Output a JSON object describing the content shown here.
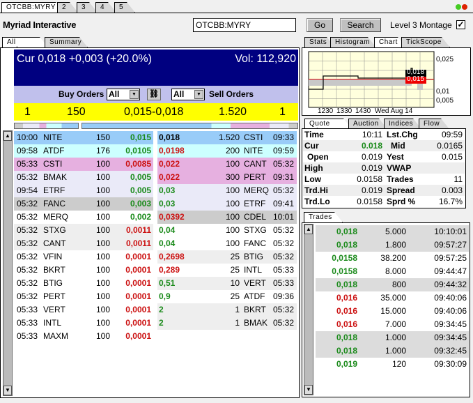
{
  "window": {
    "tabs": [
      "OTCBB:MYRY",
      "2",
      "3",
      "4",
      "5"
    ],
    "status_dots": [
      "#44cc22",
      "#dd2200"
    ]
  },
  "header": {
    "company": "Myriad Interactive",
    "symbol_value": "OTCBB:MYRY",
    "go": "Go",
    "search": "Search",
    "level3_label": "Level 3 Montage",
    "level3_checked": true
  },
  "left_tabs": [
    "All orders",
    "Summary"
  ],
  "summary": {
    "cur": "Cur 0,018 +0,003 (+20.0%)",
    "vol": "Vol: 112,920"
  },
  "filters": {
    "buy_label": "Buy Orders",
    "buy_value": "All",
    "sell_value": "All",
    "sell_label": "Sell Orders",
    "link_icon": "link-icon"
  },
  "inside": {
    "bid_count": "1",
    "bid_size": "150",
    "spread": "0,015-0,018",
    "ask_size": "1.520",
    "ask_count": "1"
  },
  "colors": {
    "blue": "#99ccf8",
    "cyan": "#ccffff",
    "pink": "#e6b0e0",
    "lavender": "#eaeaf8",
    "gray": "#cccccc",
    "lightgray": "#eeeeee",
    "white": "#ffffff",
    "green": "#1a8a1a",
    "red": "#cc1111"
  },
  "bids": [
    {
      "time": "10:00",
      "mm": "NITE",
      "size": "150",
      "price": "0,015",
      "c": "g",
      "bg": "blue"
    },
    {
      "time": "09:58",
      "mm": "ATDF",
      "size": "176",
      "price": "0,0105",
      "c": "g",
      "bg": "cyan"
    },
    {
      "time": "05:33",
      "mm": "CSTI",
      "size": "100",
      "price": "0,0085",
      "c": "r",
      "bg": "pink"
    },
    {
      "time": "05:32",
      "mm": "BMAK",
      "size": "100",
      "price": "0,005",
      "c": "g",
      "bg": "lavender"
    },
    {
      "time": "09:54",
      "mm": "ETRF",
      "size": "100",
      "price": "0,005",
      "c": "g",
      "bg": "lavender"
    },
    {
      "time": "05:32",
      "mm": "FANC",
      "size": "100",
      "price": "0,003",
      "c": "g",
      "bg": "gray"
    },
    {
      "time": "05:32",
      "mm": "MERQ",
      "size": "100",
      "price": "0,002",
      "c": "g",
      "bg": "white"
    },
    {
      "time": "05:32",
      "mm": "STXG",
      "size": "100",
      "price": "0,0011",
      "c": "r",
      "bg": "lightgray"
    },
    {
      "time": "05:32",
      "mm": "CANT",
      "size": "100",
      "price": "0,0011",
      "c": "r",
      "bg": "lightgray"
    },
    {
      "time": "05:32",
      "mm": "VFIN",
      "size": "100",
      "price": "0,0001",
      "c": "r",
      "bg": "white"
    },
    {
      "time": "05:32",
      "mm": "BKRT",
      "size": "100",
      "price": "0,0001",
      "c": "r",
      "bg": "white"
    },
    {
      "time": "05:32",
      "mm": "BTIG",
      "size": "100",
      "price": "0,0001",
      "c": "r",
      "bg": "white"
    },
    {
      "time": "05:32",
      "mm": "PERT",
      "size": "100",
      "price": "0,0001",
      "c": "r",
      "bg": "white"
    },
    {
      "time": "05:33",
      "mm": "VERT",
      "size": "100",
      "price": "0,0001",
      "c": "r",
      "bg": "white"
    },
    {
      "time": "05:33",
      "mm": "INTL",
      "size": "100",
      "price": "0,0001",
      "c": "r",
      "bg": "white"
    },
    {
      "time": "05:33",
      "mm": "MAXM",
      "size": "100",
      "price": "0,0001",
      "c": "r",
      "bg": "white"
    }
  ],
  "asks": [
    {
      "price": "0,018",
      "size": "1.520",
      "mm": "CSTI",
      "time": "09:33",
      "c": "b",
      "bg": "blue"
    },
    {
      "price": "0,0198",
      "size": "200",
      "mm": "NITE",
      "time": "09:59",
      "c": "r",
      "bg": "cyan"
    },
    {
      "price": "0,022",
      "size": "100",
      "mm": "CANT",
      "time": "05:32",
      "c": "r",
      "bg": "pink"
    },
    {
      "price": "0,022",
      "size": "300",
      "mm": "PERT",
      "time": "09:31",
      "c": "r",
      "bg": "pink"
    },
    {
      "price": "0,03",
      "size": "100",
      "mm": "MERQ",
      "time": "05:32",
      "c": "g",
      "bg": "lavender"
    },
    {
      "price": "0,03",
      "size": "100",
      "mm": "ETRF",
      "time": "09:41",
      "c": "g",
      "bg": "lavender"
    },
    {
      "price": "0,0392",
      "size": "100",
      "mm": "CDEL",
      "time": "10:01",
      "c": "r",
      "bg": "gray"
    },
    {
      "price": "0,04",
      "size": "100",
      "mm": "STXG",
      "time": "05:32",
      "c": "g",
      "bg": "white"
    },
    {
      "price": "0,04",
      "size": "100",
      "mm": "FANC",
      "time": "05:32",
      "c": "g",
      "bg": "white"
    },
    {
      "price": "0,2698",
      "size": "25",
      "mm": "BTIG",
      "time": "05:32",
      "c": "r",
      "bg": "lightgray"
    },
    {
      "price": "0,289",
      "size": "25",
      "mm": "INTL",
      "time": "05:33",
      "c": "r",
      "bg": "white"
    },
    {
      "price": "0,51",
      "size": "10",
      "mm": "VERT",
      "time": "05:33",
      "c": "g",
      "bg": "lightgray"
    },
    {
      "price": "0,9",
      "size": "25",
      "mm": "ATDF",
      "time": "09:36",
      "c": "g",
      "bg": "white"
    },
    {
      "price": "2",
      "size": "1",
      "mm": "BKRT",
      "time": "05:32",
      "c": "g",
      "bg": "lightgray"
    },
    {
      "price": "2",
      "size": "1",
      "mm": "BMAK",
      "time": "05:32",
      "c": "g",
      "bg": "lightgray"
    }
  ],
  "right_tabs": [
    "Stats",
    "Histogram",
    "Chart",
    "TickScope"
  ],
  "chart": {
    "x_ticks": [
      "1230",
      "1330",
      "1430",
      "Wed Aug 14"
    ],
    "y_ticks": [
      "0,025",
      "0,01",
      "0,005"
    ],
    "last_label": "0,018",
    "yest_label": "0,015",
    "last": 0.018,
    "yest": 0.015
  },
  "quote_tabs": [
    "Quote Info",
    "Auction",
    "Indices",
    "Flow"
  ],
  "quote": [
    {
      "l1": "Time",
      "v1": "10:11",
      "l2": "Lst.Chg",
      "v2": "09:59"
    },
    {
      "l1": "Cur",
      "v1": "0.018",
      "l2": "Mid",
      "v2": "0.0165"
    },
    {
      "l1": "Open",
      "v1": "0.019",
      "l2": "Yest",
      "v2": "0.015"
    },
    {
      "l1": "High",
      "v1": "0.019",
      "l2": "VWAP",
      "v2": ""
    },
    {
      "l1": "Low",
      "v1": "0.0158",
      "l2": "Trades",
      "v2": "11"
    },
    {
      "l1": "Trd.Hi",
      "v1": "0.019",
      "l2": "Spread",
      "v2": "0.003"
    },
    {
      "l1": "Trd.Lo",
      "v1": "0.0158",
      "l2": "Sprd %",
      "v2": "16.7%"
    }
  ],
  "trades_tab": "Trades",
  "trades": [
    {
      "price": "0,018",
      "size": "5.000",
      "time": "10:10:01",
      "c": "g",
      "bg": "#dcdcdc"
    },
    {
      "price": "0,018",
      "size": "1.800",
      "time": "09:57:27",
      "c": "g",
      "bg": "#dcdcdc"
    },
    {
      "price": "0,0158",
      "size": "38.200",
      "time": "09:57:25",
      "c": "g",
      "bg": "#ffffff"
    },
    {
      "price": "0,0158",
      "size": "8.000",
      "time": "09:44:47",
      "c": "g",
      "bg": "#ffffff"
    },
    {
      "price": "0,018",
      "size": "800",
      "time": "09:44:32",
      "c": "g",
      "bg": "#dcdcdc"
    },
    {
      "price": "0,016",
      "size": "35.000",
      "time": "09:40:06",
      "c": "r",
      "bg": "#ffffff"
    },
    {
      "price": "0,016",
      "size": "15.000",
      "time": "09:40:06",
      "c": "r",
      "bg": "#ffffff"
    },
    {
      "price": "0,016",
      "size": "7.000",
      "time": "09:34:45",
      "c": "r",
      "bg": "#ffffff"
    },
    {
      "price": "0,018",
      "size": "1.000",
      "time": "09:34:45",
      "c": "g",
      "bg": "#dcdcdc"
    },
    {
      "price": "0,018",
      "size": "1.000",
      "time": "09:32:45",
      "c": "g",
      "bg": "#dcdcdc"
    },
    {
      "price": "0,019",
      "size": "120",
      "time": "09:30:09",
      "c": "g",
      "bg": "#ffffff"
    }
  ]
}
